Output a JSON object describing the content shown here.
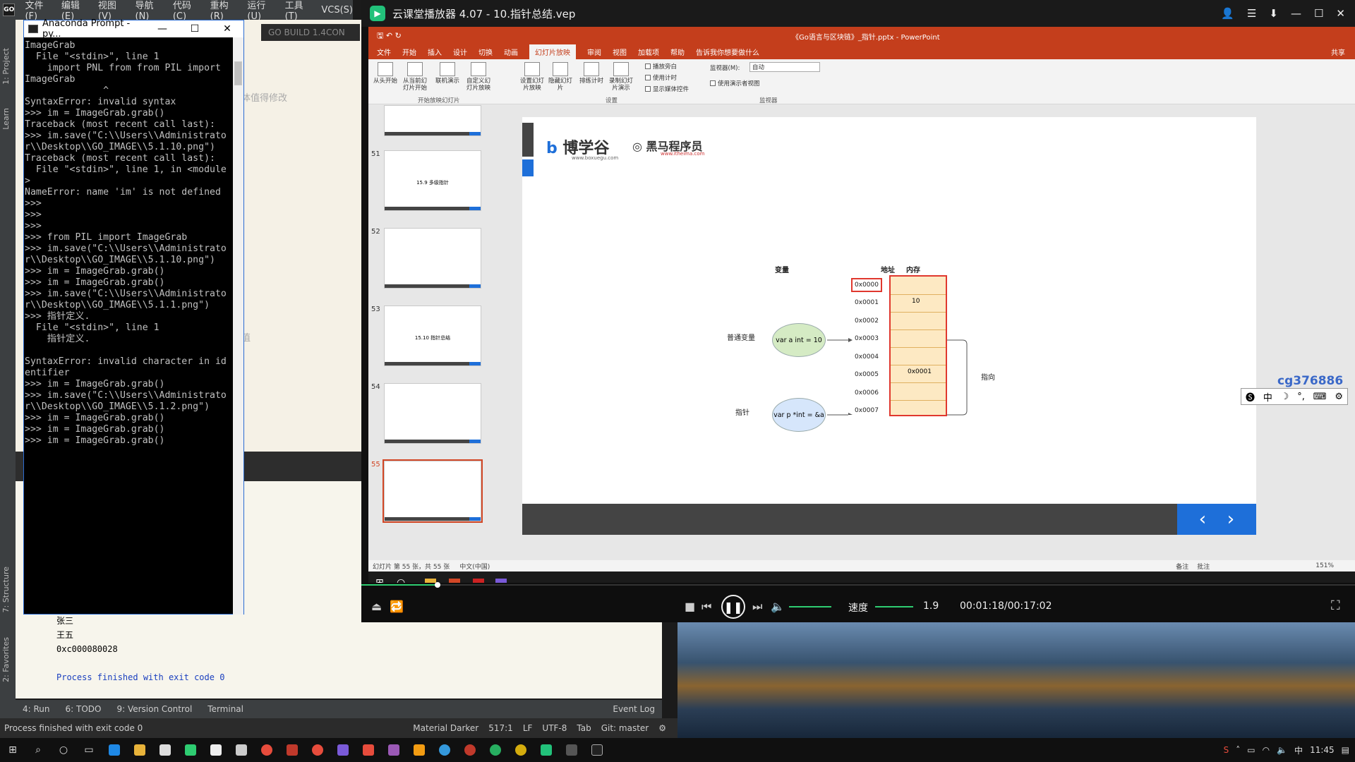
{
  "ide": {
    "menu": [
      "文件(F)",
      "编辑(E)",
      "视图(V)",
      "导航(N)",
      "代码(C)",
      "重构(R)",
      "运行(U)",
      "工具(T)",
      "VCS(S)"
    ],
    "logo": "GO",
    "left_tabs": [
      "1: Project",
      "Learn",
      "7: Structure",
      "2: Favorites"
    ],
    "editor_tab": "GO BUILD 1.4CON",
    "editor_fragments": [
      "体值得修改",
      "值"
    ],
    "console_lines": [
      "张三",
      "王五",
      "0xc000080028"
    ],
    "console_exit": "Process finished with exit code 0",
    "bottom_tabs": [
      "4: Run",
      "6: TODO",
      "9: Version Control",
      "Terminal"
    ],
    "event_log": "Event Log",
    "status_left": "Process finished with exit code 0",
    "status_right": [
      "Material Darker",
      "517:1",
      "LF",
      "UTF-8",
      "Tab",
      "Git: master"
    ]
  },
  "cmd": {
    "title": "Anaconda Prompt - py...",
    "controls": [
      "—",
      "☐",
      "✕"
    ],
    "text": "ImageGrab\n  File \"<stdin>\", line 1\n    import PNL from from PIL import\nImageGrab\n              ^\nSyntaxError: invalid syntax\n>>> im = ImageGrab.grab()\nTraceback (most recent call last):\n>>> im.save(\"C:\\\\Users\\\\Administrato\nr\\\\Desktop\\\\GO_IMAGE\\\\5.1.10.png\")\nTraceback (most recent call last):\n  File \"<stdin>\", line 1, in <module\n>\nNameError: name 'im' is not defined\n>>>\n>>>\n>>>\n>>> from PIL import ImageGrab\n>>> im.save(\"C:\\\\Users\\\\Administrato\nr\\\\Desktop\\\\GO_IMAGE\\\\5.1.10.png\")\n>>> im = ImageGrab.grab()\n>>> im = ImageGrab.grab()\n>>> im.save(\"C:\\\\Users\\\\Administrato\nr\\\\Desktop\\\\GO_IMAGE\\\\5.1.1.png\")\n>>> 指针定义.\n  File \"<stdin>\", line 1\n    指针定义.\n\nSyntaxError: invalid character in id\nentifier\n>>> im = ImageGrab.grab()\n>>> im.save(\"C:\\\\Users\\\\Administrato\nr\\\\Desktop\\\\GO_IMAGE\\\\5.1.2.png\")\n>>> im = ImageGrab.grab()\n>>> im = ImageGrab.grab()\n>>> im = ImageGrab.grab()"
  },
  "player": {
    "title": "云课堂播放器 4.07 - 10.指针总结.vep",
    "speed_label": "速度",
    "speed_value": "1.9",
    "time": "00:01:18/00:17:02",
    "progress": 0.077
  },
  "ppt": {
    "title": "《Go语言与区块链》_指针.pptx - PowerPoint",
    "tabs": [
      "文件",
      "开始",
      "插入",
      "设计",
      "切换",
      "动画",
      "幻灯片放映",
      "审阅",
      "视图",
      "加载项",
      "帮助"
    ],
    "active_tab": "幻灯片放映",
    "tell_me": "告诉我你想要做什么",
    "share": "共享",
    "ribbon_buttons": [
      "从头开始",
      "从当前幻灯片开始",
      "联机演示",
      "自定义幻灯片放映",
      "设置幻灯片放映",
      "隐藏幻灯片",
      "排练计时",
      "录制幻灯片演示"
    ],
    "checkboxes": [
      "播放旁白",
      "使用计时",
      "显示媒体控件"
    ],
    "monitor_label": "监视器(M):",
    "monitor_value": "自动",
    "presenter_view": "使用演示者视图",
    "groups": [
      "开始放映幻灯片",
      "设置",
      "监视器"
    ],
    "thumbs": [
      {
        "num": "51",
        "title": "15.9 多级指针"
      },
      {
        "num": "52",
        "title": ""
      },
      {
        "num": "53",
        "title": "15.10 指针总结"
      },
      {
        "num": "54",
        "title": ""
      },
      {
        "num": "55",
        "title": ""
      }
    ],
    "status_left": "幻灯片 第 55 张，共 55 张",
    "status_lang": "中文(中国)",
    "status_notes": "备注",
    "status_comments": "批注",
    "zoom": "151%"
  },
  "slide": {
    "brand1": "博学谷",
    "brand1_url": "www.boxuegu.com",
    "brand2": "黑马程序员",
    "brand2_url": "www.itheima.com",
    "col_var": "变量",
    "col_addr": "地址",
    "col_mem": "内存",
    "label_normal": "普通变量",
    "label_ptr": "指针",
    "oval_normal": "var a int = 10",
    "oval_ptr": "var p *int = &a",
    "addresses": [
      "0x0000",
      "0x0001",
      "0x0002",
      "0x0003",
      "0x0004",
      "0x0005",
      "0x0006",
      "0x0007"
    ],
    "mem_value_1": "10",
    "mem_value_5": "0x0001",
    "points_to": "指向"
  },
  "overlay": {
    "watermark": "cg376886",
    "ime": [
      "中",
      "☽",
      "°,",
      "⌨",
      "⚙"
    ]
  },
  "taskbar": {
    "time": "11:45"
  }
}
